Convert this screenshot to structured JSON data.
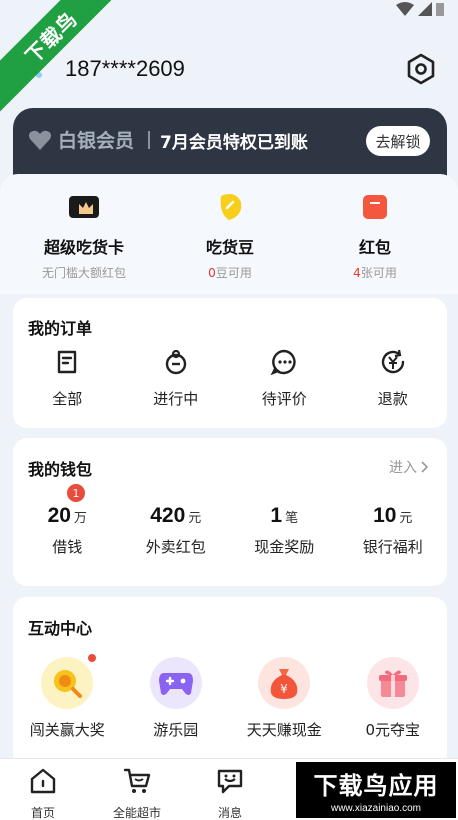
{
  "user": {
    "phone": "187****2609"
  },
  "vip": {
    "logo_text": "白银会员",
    "promo": "7月会员特权已到账",
    "unlock_button": "去解锁"
  },
  "stats": [
    {
      "title": "超级吃货卡",
      "sub": "无门槛大额红包",
      "sub_highlight": "",
      "icon": "crown-card-icon"
    },
    {
      "title": "吃货豆",
      "sub_highlight": "0",
      "sub": "豆可用",
      "icon": "bean-icon"
    },
    {
      "title": "红包",
      "sub_highlight": "4",
      "sub": "张可用",
      "icon": "red-envelope-icon"
    }
  ],
  "orders": {
    "title": "我的订单",
    "items": [
      {
        "label": "全部",
        "icon": "order-all-icon"
      },
      {
        "label": "进行中",
        "icon": "order-inprogress-icon"
      },
      {
        "label": "待评价",
        "icon": "order-review-icon"
      },
      {
        "label": "退款",
        "icon": "refund-icon"
      }
    ]
  },
  "wallet": {
    "title": "我的钱包",
    "enter": "进入",
    "items": [
      {
        "value": "20",
        "unit": "万",
        "label": "借钱",
        "badge": "1"
      },
      {
        "value": "420",
        "unit": "元",
        "label": "外卖红包",
        "badge": ""
      },
      {
        "value": "1",
        "unit": "笔",
        "label": "现金奖励",
        "badge": ""
      },
      {
        "value": "10",
        "unit": "元",
        "label": "银行福利",
        "badge": ""
      }
    ]
  },
  "fun": {
    "title": "互动中心",
    "items": [
      {
        "label": "闯关赢大奖",
        "icon": "magnifier-prize-icon"
      },
      {
        "label": "游乐园",
        "icon": "gamepad-icon"
      },
      {
        "label": "天天赚现金",
        "icon": "money-bag-icon"
      },
      {
        "label": "0元夺宝",
        "icon": "gift-box-icon"
      }
    ]
  },
  "nav": [
    {
      "label": "首页",
      "icon": "home-icon"
    },
    {
      "label": "全能超市",
      "icon": "cart-icon"
    },
    {
      "label": "消息",
      "icon": "message-icon"
    }
  ],
  "watermark": {
    "ribbon": "下载鸟",
    "brand": "下载鸟应用",
    "url": "www.xiazainiao.com"
  },
  "colors": {
    "accent_red": "#e94b3c",
    "vip_bg": "#2e3644",
    "green_watermark": "#21a043"
  }
}
